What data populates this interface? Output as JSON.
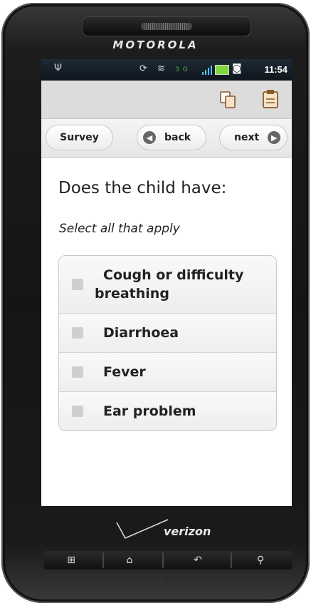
{
  "device": {
    "brand": "MOTOROLA",
    "carrier": "verizon"
  },
  "statusbar": {
    "time": "11:54",
    "network": "3G"
  },
  "actionbar": {
    "icons": [
      "copy-icon",
      "clipboard-icon"
    ]
  },
  "nav": {
    "survey_label": "Survey",
    "back_label": "back",
    "next_label": "next"
  },
  "form": {
    "question": "Does the child have:",
    "hint": "Select all that apply",
    "options": [
      {
        "label": "Cough or difficulty breathing",
        "checked": false
      },
      {
        "label": "Diarrhoea",
        "checked": false
      },
      {
        "label": "Fever",
        "checked": false
      },
      {
        "label": "Ear problem",
        "checked": false
      }
    ]
  },
  "hardware_keys": [
    "menu-icon",
    "home-icon",
    "back-icon",
    "search-icon"
  ],
  "colors": {
    "actionbar_bg": "#dcdcdc",
    "battery": "#7dd83a",
    "signal": "#56c1f0"
  }
}
